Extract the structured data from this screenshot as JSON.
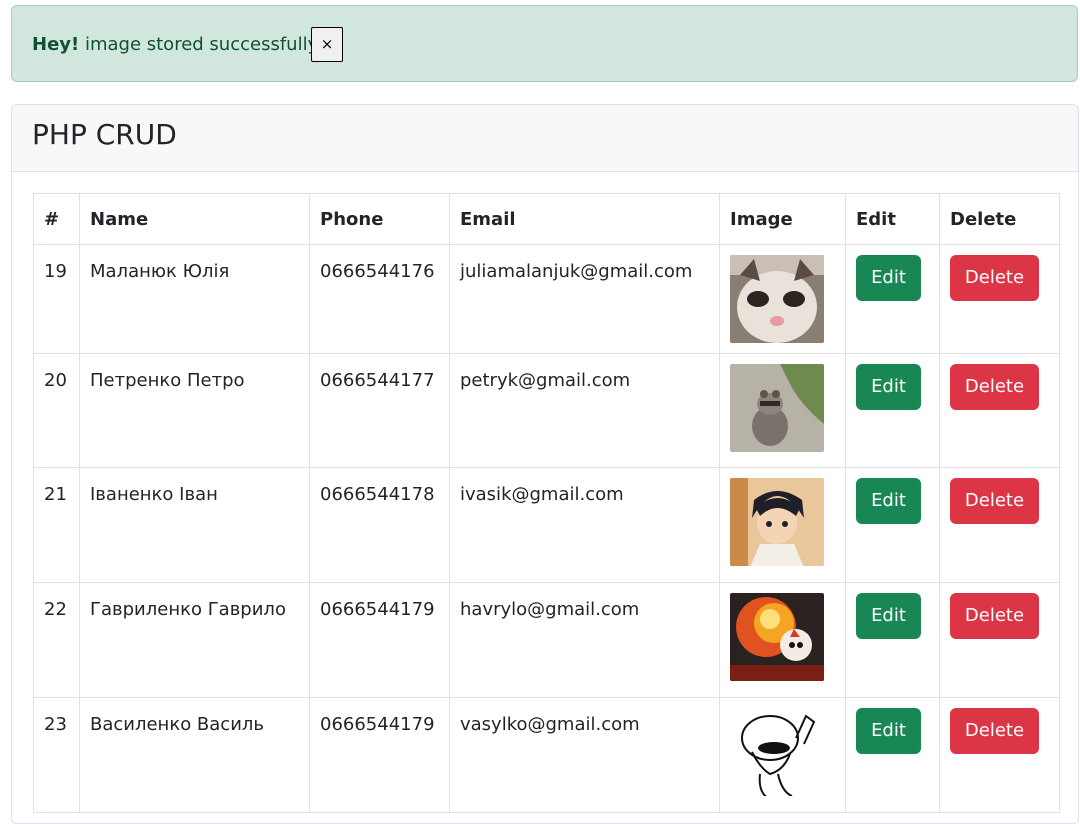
{
  "alert": {
    "strong": "Hey!",
    "message": "image stored successfully",
    "close": "×"
  },
  "card": {
    "title": "PHP CRUD"
  },
  "table": {
    "headers": [
      "#",
      "Name",
      "Phone",
      "Email",
      "Image",
      "Edit",
      "Delete"
    ],
    "rows": [
      {
        "id": "19",
        "name": "Маланюк Юлія",
        "phone": "0666544176",
        "email": "juliamalanjuk@gmail.com",
        "image": "kitten-photo",
        "edit": "Edit",
        "delete": "Delete"
      },
      {
        "id": "20",
        "name": "Петренко Петро",
        "phone": "0666544177",
        "email": "petryk@gmail.com",
        "image": "raccoon-photo",
        "edit": "Edit",
        "delete": "Delete"
      },
      {
        "id": "21",
        "name": "Іваненко Іван",
        "phone": "0666544178",
        "email": "ivasik@gmail.com",
        "image": "anime-boy-image",
        "edit": "Edit",
        "delete": "Delete"
      },
      {
        "id": "22",
        "name": "Гавриленко Гаврило",
        "phone": "0666544179",
        "email": "havrylo@gmail.com",
        "image": "cartoon-explosion-image",
        "edit": "Edit",
        "delete": "Delete"
      },
      {
        "id": "23",
        "name": "Василенко Василь",
        "phone": "0666544179",
        "email": "vasylko@gmail.com",
        "image": "doodle-sketch-image",
        "edit": "Edit",
        "delete": "Delete"
      }
    ]
  },
  "colors": {
    "success": "#198754",
    "danger": "#dc3545",
    "alert_bg": "#d1e7dd",
    "alert_text": "#0f5132"
  }
}
